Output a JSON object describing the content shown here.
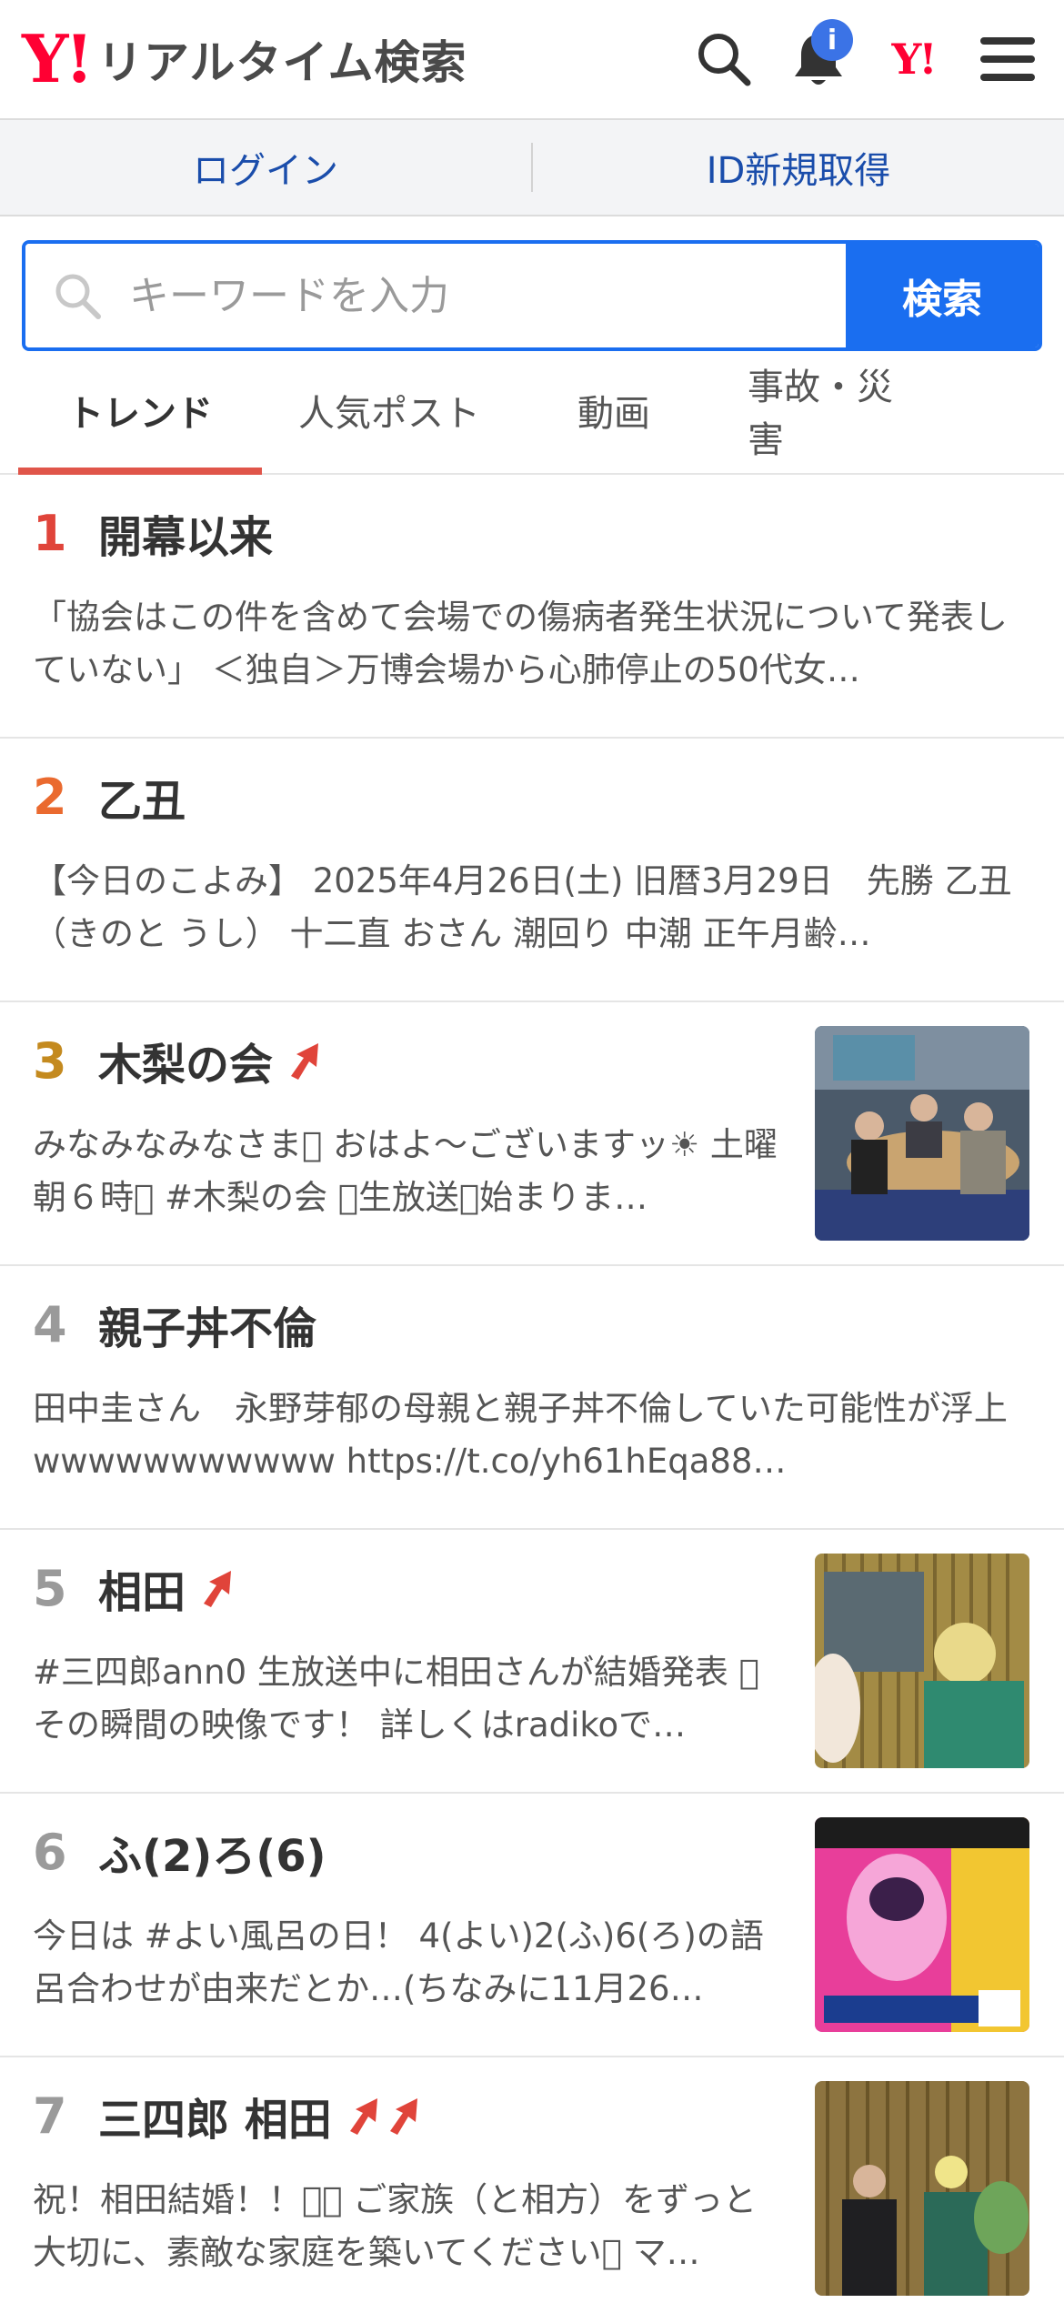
{
  "header": {
    "logo_mark": "Y!",
    "logo_text": "リアルタイム検索",
    "notification_badge": "i",
    "yahoo_mark": "Y!",
    "icons": [
      "search-icon",
      "bell-icon",
      "yahoo-logo",
      "hamburger-menu-icon"
    ]
  },
  "login_bar": {
    "login": "ログイン",
    "register": "ID新規取得"
  },
  "search": {
    "placeholder": "キーワードを入力",
    "button": "検索"
  },
  "tabs": [
    {
      "label": "トレンド",
      "active": true
    },
    {
      "label": "人気ポスト",
      "active": false
    },
    {
      "label": "動画",
      "active": false
    },
    {
      "label": "事故・災害",
      "active": false
    }
  ],
  "colors": {
    "brand_red": "#ff0033",
    "primary_blue": "#1a6ef0",
    "link_blue": "#1a4dab",
    "tab_underline": "#e0554a",
    "rank1": "#e0443a",
    "rank2": "#ea6a2f",
    "rank3": "#c48a1f",
    "rank_other": "#9a9a9a",
    "trend_arrow": "#e0443a"
  },
  "trends": [
    {
      "rank": "1",
      "term": "開幕以来",
      "arrows": 0,
      "has_thumb": false,
      "desc": "「協会はこの件を含めて会場での傷病者発生状況について発表していない」 ＜独自＞万博会場から心肺停止の50代女…"
    },
    {
      "rank": "2",
      "term": "乙丑",
      "arrows": 0,
      "has_thumb": false,
      "desc": "【今日のこよみ】 2025年4月26日(土) 旧暦3月29日　先勝 乙丑（きのと うし） 十二直 おさん 潮回り 中潮 正午月齢…"
    },
    {
      "rank": "3",
      "term": "木梨の会",
      "arrows": 1,
      "has_thumb": true,
      "desc": "みなみなみなさま󾌸 おはよ〜ございますッ☀ 土曜朝６時󾭛 #木梨の会 󾠱生放送󾠱始まりま…"
    },
    {
      "rank": "4",
      "term": "親子丼不倫",
      "arrows": 0,
      "has_thumb": false,
      "desc": "田中圭さん　永野芽郁の母親と親子丼不倫していた可能性が浮上wwwwwwwwwww https://t.co/yh61hEqa88…"
    },
    {
      "rank": "5",
      "term": "相田",
      "arrows": 1,
      "has_thumb": true,
      "desc": "#三四郎ann0 生放送中に相田さんが結婚発表 󾓦 その瞬間の映像です！ 詳しくはradikoで…"
    },
    {
      "rank": "6",
      "term": "ふ(2)ろ(6)",
      "arrows": 0,
      "has_thumb": true,
      "desc": "今日は #よい風呂の日！ 4(よい)2(ふ)6(ろ)の語呂合わせが由来だとか…(ちなみに11月26…"
    },
    {
      "rank": "7",
      "term": "三四郎 相田",
      "arrows": 2,
      "has_thumb": true,
      "desc": "祝！相田結婚！！󾓦󾓦 ご家族（と相方）をずっと大切に、素敵な家庭を築いてください󾓦 マ…"
    }
  ]
}
